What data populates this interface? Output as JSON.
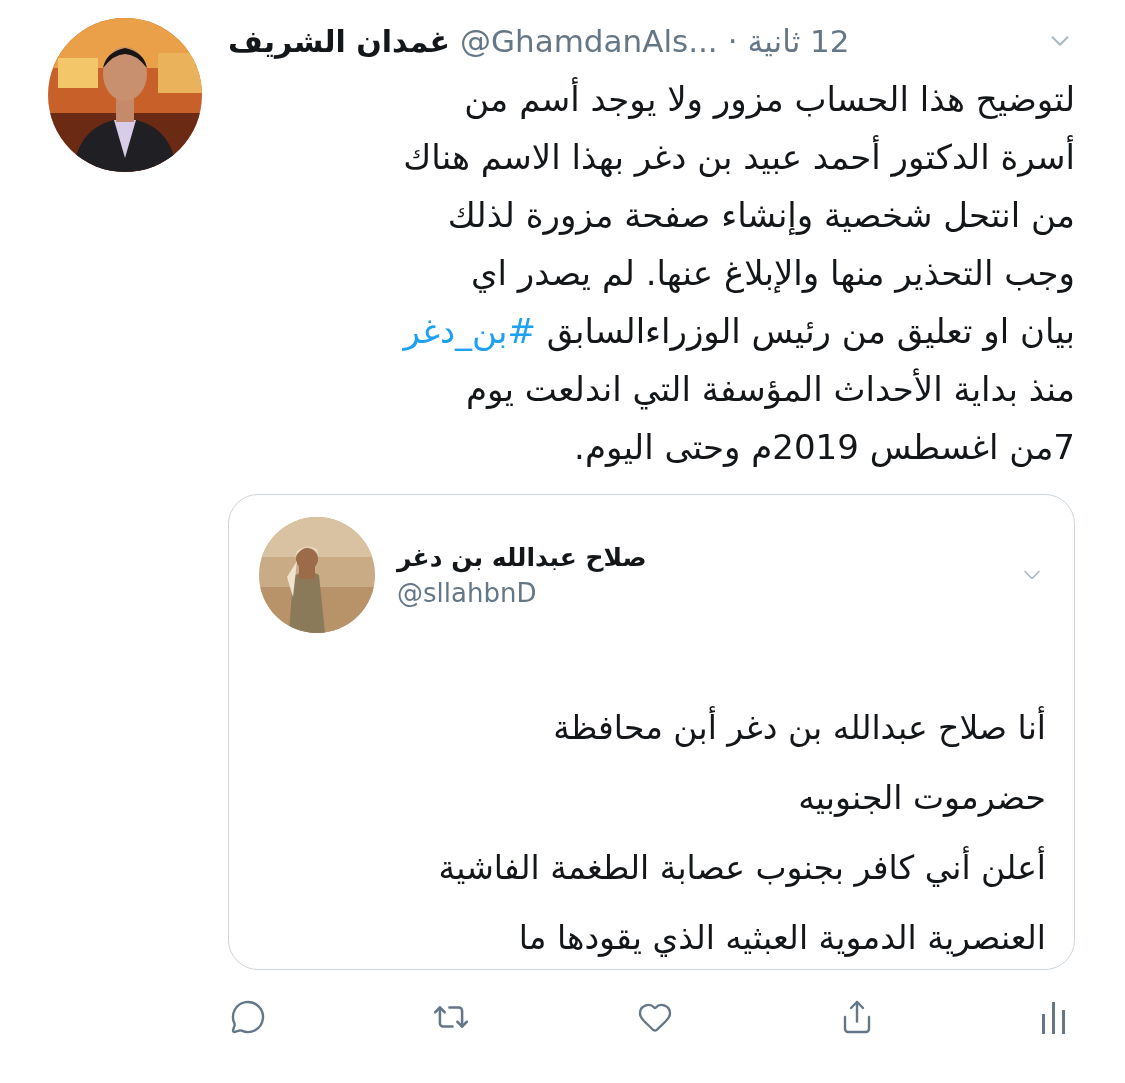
{
  "tweet": {
    "author": {
      "name": "غمدان الشريف",
      "handle": "@GhamdanAls..."
    },
    "separator": "·",
    "time": "12 ثانية",
    "body": [
      {
        "kind": "text",
        "text": "لتوضيح هذا الحساب مزور ولا يوجد أسم من\nأسرة الدكتور أحمد عبيد بن دغر بهذا الاسم هناك\nمن انتحل شخصية وإنشاء صفحة مزورة لذلك\nوجب التحذير منها والإبلاغ عنها. لم يصدر اي\nبيان او تعليق من رئيس الوزراءالسابق "
      },
      {
        "kind": "hashtag",
        "text": "#بن_دغر"
      },
      {
        "kind": "text",
        "text": "\nمنذ بداية الأحداث المؤسفة التي اندلعت يوم\n7من اغسطس 2019م وحتى اليوم."
      }
    ],
    "quoted_tweet": {
      "author": {
        "name": "صلاح عبدالله بن دغر",
        "handle": "@sllahbnD"
      },
      "text": "أنا صلاح عبدالله بن دغر أبن محافظة\nحضرموت الجنوبيه\nأعلن أني كافر بجنوب عصابة الطغمة الفاشية\nالعنصرية الدموية العبثيه الذي يقودها ما"
    }
  }
}
